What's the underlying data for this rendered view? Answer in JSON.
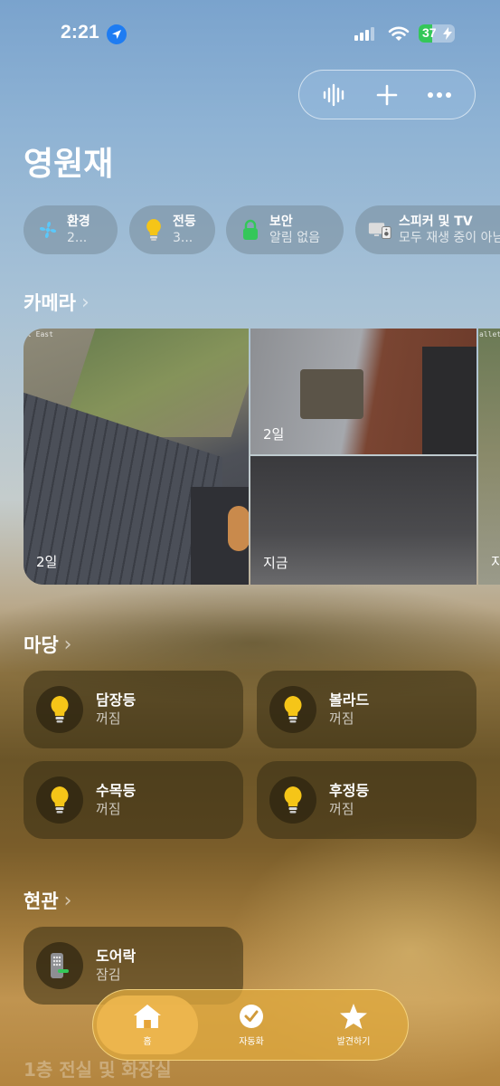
{
  "status_bar": {
    "time": "2:21",
    "battery": "37"
  },
  "home": {
    "title": "영원재"
  },
  "chips": [
    {
      "label": "환경",
      "sub": "2..."
    },
    {
      "label": "전등",
      "sub": "3..."
    },
    {
      "label": "보안",
      "sub": "알림 없음"
    },
    {
      "label": "스피커 및 TV",
      "sub": "모두 재생 중이 아님"
    }
  ],
  "cameras": {
    "title": "카메라",
    "main_overlay": "t East",
    "right_overlay": "allet Se",
    "feeds": [
      {
        "label": "2일"
      },
      {
        "label": "2일"
      },
      {
        "label": "지금"
      },
      {
        "label": "지"
      }
    ]
  },
  "yard": {
    "title": "마당",
    "tiles": [
      {
        "name": "담장등",
        "state": "꺼짐"
      },
      {
        "name": "볼라드",
        "state": "꺼짐"
      },
      {
        "name": "수목등",
        "state": "꺼짐"
      },
      {
        "name": "후정등",
        "state": "꺼짐"
      }
    ]
  },
  "entrance": {
    "title": "현관",
    "tiles": [
      {
        "name": "도어락",
        "state": "잠김"
      }
    ]
  },
  "next_section": {
    "title": "1층 전실 및 화장실"
  },
  "tabs": [
    {
      "label": "홈",
      "icon": "house-icon",
      "active": true
    },
    {
      "label": "자동화",
      "icon": "clock-check-icon",
      "active": false
    },
    {
      "label": "발견하기",
      "icon": "star-icon",
      "active": false
    }
  ],
  "colors": {
    "bulb_on": "#f5c518",
    "lock_green": "#34c759",
    "location_blue": "#1e7cf2"
  }
}
